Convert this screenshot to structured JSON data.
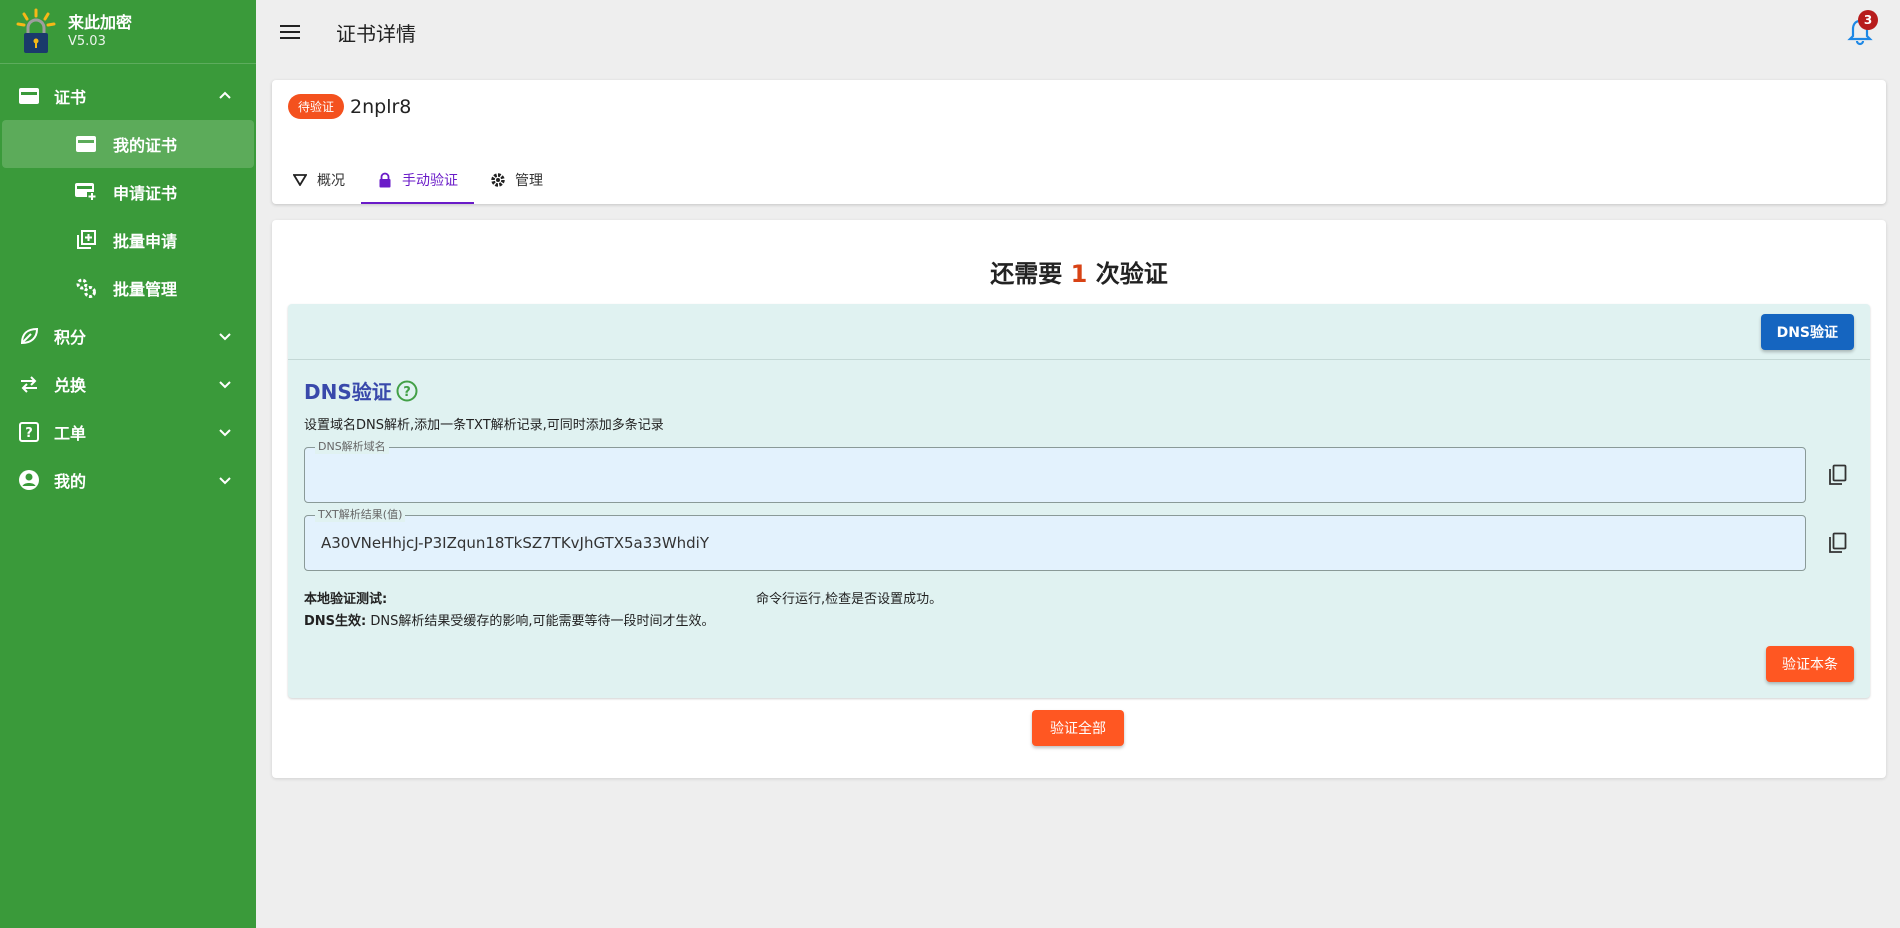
{
  "colors": {
    "sidebar_bg": "#3a9a3a",
    "sidebar_active": "#5cab5a",
    "accent_orange": "#ff5722",
    "accent_blue": "#1565c0",
    "tab_active": "#6a1bc8",
    "panel_bg": "#e0f2f1",
    "badge_red": "#b71c1c"
  },
  "brand": {
    "name": "来此加密",
    "version": "V5.03",
    "logo": "lock-sun-logo"
  },
  "sidebar": {
    "groups": [
      {
        "label": "证书",
        "icon": "card-icon",
        "expanded": true,
        "items": [
          {
            "label": "我的证书",
            "icon": "card-icon",
            "active": true
          },
          {
            "label": "申请证书",
            "icon": "card-add-icon"
          },
          {
            "label": "批量申请",
            "icon": "library-add-icon"
          },
          {
            "label": "批量管理",
            "icon": "gears-icon"
          }
        ]
      },
      {
        "label": "积分",
        "icon": "leaf-icon"
      },
      {
        "label": "兑换",
        "icon": "swap-icon"
      },
      {
        "label": "工单",
        "icon": "question-box-icon"
      },
      {
        "label": "我的",
        "icon": "account-icon"
      }
    ]
  },
  "header": {
    "title": "证书详情",
    "notification_count": "3"
  },
  "cert": {
    "status": "待验证",
    "id": "2nplr8",
    "tabs": [
      {
        "label": "概况",
        "icon": "triangle-down-icon"
      },
      {
        "label": "手动验证",
        "icon": "lock-icon",
        "active": true
      },
      {
        "label": "管理",
        "icon": "gear-icon"
      }
    ]
  },
  "verify": {
    "remaining_prefix": "还需要",
    "remaining_count": "1",
    "remaining_suffix": "次验证",
    "method_button": "DNS验证",
    "section_title": "DNS验证",
    "description": "设置域名DNS解析,添加一条TXT解析记录,可同时添加多条记录",
    "dns_field": {
      "label": "DNS解析域名",
      "value": ""
    },
    "txt_field": {
      "label": "TXT解析结果(值)",
      "value": "A30VNeHhjcJ-P3IZqun18TkSZ7TKvJhGTX5a33WhdiY"
    },
    "local_test_label": "本地验证测试:",
    "local_test_text": "命令行运行,检查是否设置成功。",
    "dns_effect_label": "DNS生效:",
    "dns_effect_text": "DNS解析结果受缓存的影响,可能需要等待一段时间才生效。",
    "verify_one_button": "验证本条",
    "verify_all_button": "验证全部"
  }
}
